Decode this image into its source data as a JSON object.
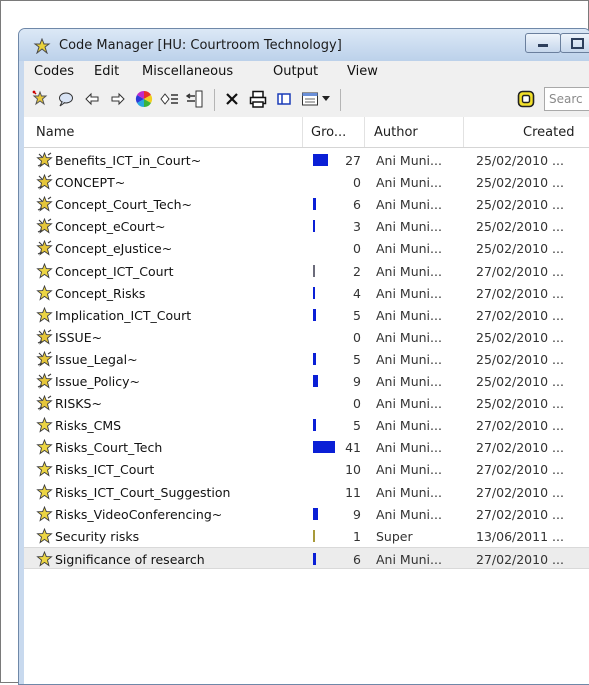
{
  "window": {
    "title": "Code Manager [HU: Courtroom Technology]"
  },
  "menu": [
    "Codes",
    "Edit",
    "Miscellaneous",
    "Output",
    "View"
  ],
  "toolbar": {
    "search_placeholder": "Searc",
    "buttons": [
      "new-code-icon",
      "comment-icon",
      "back-arrow-icon",
      "forward-arrow-icon",
      "color-wheel-icon",
      "code-family-icon",
      "merge-icon",
      "delete-icon",
      "print-icon",
      "single-pane-icon",
      "view-options-icon",
      "dropdown-icon",
      "filter-icon"
    ]
  },
  "columns": {
    "name": "Name",
    "groundedness": "Gro...",
    "author": "Author",
    "created": "Created"
  },
  "rows": [
    {
      "name": "Benefits_ICT_in_Court~",
      "count": "27",
      "author": "Ani Muni...",
      "created": "25/02/2010 ...",
      "icon": "code-family",
      "bar": 0.66,
      "bar_color": "#0a1fd6"
    },
    {
      "name": "CONCEPT~",
      "count": "0",
      "author": "Ani Muni...",
      "created": "25/02/2010 ...",
      "icon": "code-family",
      "bar": 0,
      "bar_color": "#0a1fd6"
    },
    {
      "name": "Concept_Court_Tech~",
      "count": "6",
      "author": "Ani Muni...",
      "created": "25/02/2010 ...",
      "icon": "code-family",
      "bar": 0.15,
      "bar_color": "#0a1fd6"
    },
    {
      "name": "Concept_eCourt~",
      "count": "3",
      "author": "Ani Muni...",
      "created": "25/02/2010 ...",
      "icon": "code-family",
      "bar": 0.07,
      "bar_color": "#0a1fd6"
    },
    {
      "name": "Concept_eJustice~",
      "count": "0",
      "author": "Ani Muni...",
      "created": "25/02/2010 ...",
      "icon": "code-family",
      "bar": 0,
      "bar_color": "#0a1fd6"
    },
    {
      "name": "Concept_ICT_Court",
      "count": "2",
      "author": "Ani Muni...",
      "created": "27/02/2010 ...",
      "icon": "code",
      "bar": 0.05,
      "bar_color": "#6b6b7a"
    },
    {
      "name": "Concept_Risks",
      "count": "4",
      "author": "Ani Muni...",
      "created": "27/02/2010 ...",
      "icon": "code",
      "bar": 0.1,
      "bar_color": "#0a1fd6"
    },
    {
      "name": "Implication_ICT_Court",
      "count": "5",
      "author": "Ani Muni...",
      "created": "27/02/2010 ...",
      "icon": "code",
      "bar": 0.12,
      "bar_color": "#0a1fd6"
    },
    {
      "name": "ISSUE~",
      "count": "0",
      "author": "Ani Muni...",
      "created": "25/02/2010 ...",
      "icon": "code-family",
      "bar": 0,
      "bar_color": "#0a1fd6"
    },
    {
      "name": "Issue_Legal~",
      "count": "5",
      "author": "Ani Muni...",
      "created": "25/02/2010 ...",
      "icon": "code-family",
      "bar": 0.12,
      "bar_color": "#0a1fd6"
    },
    {
      "name": "Issue_Policy~",
      "count": "9",
      "author": "Ani Muni...",
      "created": "25/02/2010 ...",
      "icon": "code-family",
      "bar": 0.22,
      "bar_color": "#0a1fd6"
    },
    {
      "name": "RISKS~",
      "count": "0",
      "author": "Ani Muni...",
      "created": "25/02/2010 ...",
      "icon": "code-family",
      "bar": 0,
      "bar_color": "#0a1fd6"
    },
    {
      "name": "Risks_CMS",
      "count": "5",
      "author": "Ani Muni...",
      "created": "27/02/2010 ...",
      "icon": "code",
      "bar": 0.12,
      "bar_color": "#0a1fd6"
    },
    {
      "name": "Risks_Court_Tech",
      "count": "41",
      "author": "Ani Muni...",
      "created": "27/02/2010 ...",
      "icon": "code",
      "bar": 1.0,
      "bar_color": "#0a1fd6"
    },
    {
      "name": "Risks_ICT_Court",
      "count": "10",
      "author": "Ani Muni...",
      "created": "27/02/2010 ...",
      "icon": "code",
      "bar": 0,
      "bar_color": "#0a1fd6"
    },
    {
      "name": "Risks_ICT_Court_Suggestion",
      "count": "11",
      "author": "Ani Muni...",
      "created": "27/02/2010 ...",
      "icon": "code",
      "bar": 0,
      "bar_color": "#0a1fd6"
    },
    {
      "name": "Risks_VideoConferencing~",
      "count": "9",
      "author": "Ani Muni...",
      "created": "27/02/2010 ...",
      "icon": "code",
      "bar": 0.22,
      "bar_color": "#0a1fd6"
    },
    {
      "name": "Security risks",
      "count": "1",
      "author": "Super",
      "created": "13/06/2011 ...",
      "icon": "code",
      "bar": 0.04,
      "bar_color": "#a89a3a"
    },
    {
      "name": "Significance of research",
      "count": "6",
      "author": "Ani Muni...",
      "created": "27/02/2010 ...",
      "icon": "code",
      "bar": 0.15,
      "bar_color": "#0a1fd6",
      "selected": true
    }
  ],
  "scrollbar": {
    "thumb_fraction": 0.45
  }
}
